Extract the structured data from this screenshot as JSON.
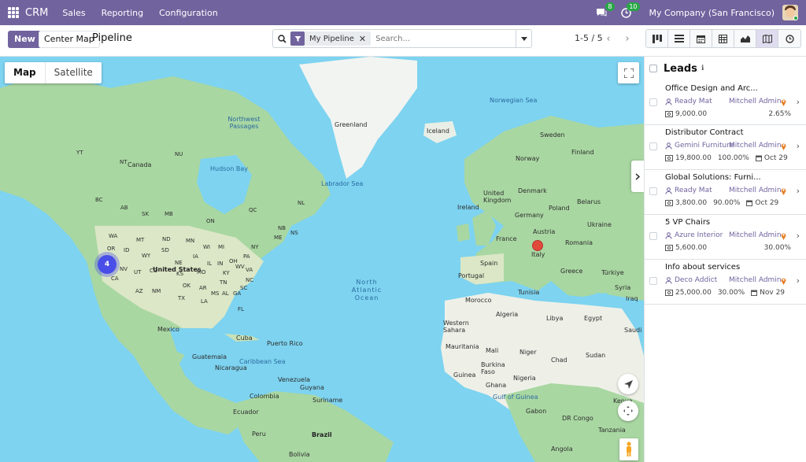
{
  "navbar": {
    "app_name": "CRM",
    "menu": [
      "Sales",
      "Reporting",
      "Configuration"
    ],
    "messages_count": "8",
    "activities_count": "10",
    "company": "My Company (San Francisco)"
  },
  "control_panel": {
    "new_label": "New",
    "center_map_label": "Center Map",
    "breadcrumb": "Pipeline",
    "search_facet": "My Pipeline",
    "search_placeholder": "Search...",
    "pager": "1-5 / 5",
    "views": [
      "kanban-icon",
      "list-icon",
      "calendar-icon",
      "pivot-icon",
      "graph-icon",
      "map-icon",
      "activity-icon"
    ],
    "active_view": "map-icon"
  },
  "map": {
    "type_map_label": "Map",
    "type_satellite_label": "Satellite",
    "cluster_count": "4",
    "labels": {
      "greenland": "Greenland",
      "iceland": "Iceland",
      "canada": "Canada",
      "northwest_passages": "Northwest Passages",
      "hudson_bay": "Hudson Bay",
      "labrador_sea": "Labrador Sea",
      "norwegian_sea": "Norwegian Sea",
      "sweden": "Sweden",
      "finland": "Finland",
      "norway": "Norway",
      "united_kingdom": "United Kingdom",
      "denmark": "Denmark",
      "ireland": "Ireland",
      "germany": "Germany",
      "poland": "Poland",
      "belarus": "Belarus",
      "ukraine": "Ukraine",
      "france": "France",
      "austria": "Austria",
      "romania": "Romania",
      "italy": "Italy",
      "spain": "Spain",
      "portugal": "Portugal",
      "greece": "Greece",
      "turkiye": "Türkiye",
      "syria": "Syria",
      "iraq": "Iraq",
      "morocco": "Morocco",
      "tunisia": "Tunisia",
      "algeria": "Algeria",
      "libya": "Libya",
      "egypt": "Egypt",
      "saudi": "Saudi A",
      "western_sahara": "Western Sahara",
      "mauritania": "Mauritania",
      "mali": "Mali",
      "niger": "Niger",
      "chad": "Chad",
      "sudan": "Sudan",
      "burkina": "Burkina Faso",
      "guinea": "Guinea",
      "ghana": "Ghana",
      "nigeria": "Nigeria",
      "gulf_guinea": "Gulf of Guinea",
      "gabon": "Gabon",
      "dr_congo": "DR Congo",
      "kenya": "Kenya",
      "tanzania": "Tanzania",
      "angola": "Angola",
      "north_atlantic": "North Atlantic Ocean",
      "united_states": "United States",
      "mexico": "Mexico",
      "cuba": "Cuba",
      "puerto_rico": "Puerto Rico",
      "guatemala": "Guatemala",
      "nicaragua": "Nicaragua",
      "caribbean": "Caribbean Sea",
      "venezuela": "Venezuela",
      "colombia": "Colombia",
      "guyana": "Guyana",
      "suriname": "Suriname",
      "ecuador": "Ecuador",
      "peru": "Peru",
      "brazil": "Brazil",
      "bolivia": "Bolivia",
      "wa": "WA",
      "mt": "MT",
      "nd": "ND",
      "mn": "MN",
      "or": "OR",
      "id": "ID",
      "sd": "SD",
      "wy": "WY",
      "nv": "NV",
      "ut": "UT",
      "co": "CO",
      "ne": "NE",
      "ks": "KS",
      "ca": "CA",
      "az": "AZ",
      "nm": "NM",
      "ok": "OK",
      "tx": "TX",
      "ia": "IA",
      "mo": "MO",
      "ar": "AR",
      "la": "LA",
      "ms": "MS",
      "al": "AL",
      "ga": "GA",
      "fl": "FL",
      "tn": "TN",
      "ky": "KY",
      "oh": "OH",
      "in": "IN",
      "il": "IL",
      "wi": "WI",
      "mi": "MI",
      "pa": "PA",
      "ny": "NY",
      "va": "VA",
      "nc": "NC",
      "sc": "SC",
      "wv": "WV",
      "me": "ME",
      "bc": "BC",
      "ab": "AB",
      "sk": "SK",
      "mb": "MB",
      "on": "ON",
      "qc": "QC",
      "nl": "NL",
      "nb": "NB",
      "ns": "NS",
      "nu": "NU",
      "nt": "NT",
      "yt": "YT"
    }
  },
  "sidebar": {
    "title": "Leads",
    "leads": [
      {
        "name": "Office Design and Arc...",
        "customer": "Ready Mat",
        "user": "Mitchell Admin",
        "revenue": "9,000.00",
        "probability": "2.65%",
        "date": ""
      },
      {
        "name": "Distributor Contract",
        "customer": "Gemini Furniture",
        "user": "Mitchell Admin",
        "revenue": "19,800.00",
        "probability": "100.00%",
        "date": "Oct 29"
      },
      {
        "name": "Global Solutions: Furni...",
        "customer": "Ready Mat",
        "user": "Mitchell Admin",
        "revenue": "3,800.00",
        "probability": "90.00%",
        "date": "Oct 29"
      },
      {
        "name": "5 VP Chairs",
        "customer": "Azure Interior",
        "user": "Mitchell Admin",
        "revenue": "5,600.00",
        "probability": "30.00%",
        "date": ""
      },
      {
        "name": "Info about services",
        "customer": "Deco Addict",
        "user": "Mitchell Admin",
        "revenue": "25,000.00",
        "probability": "30.00%",
        "date": "Nov 29"
      }
    ]
  }
}
